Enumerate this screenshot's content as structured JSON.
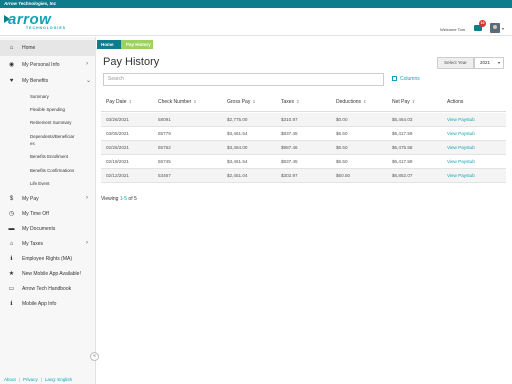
{
  "topbar": {
    "company": "Arrow Technologies, Inc"
  },
  "header": {
    "logo_text": "arrow",
    "logo_sub": "TECHNOLOGIES",
    "welcome": "Welcome Tom",
    "mail_count": "10"
  },
  "sidebar": {
    "items": [
      {
        "label": "Home",
        "icon": "home-icon",
        "glyph": "⌂"
      },
      {
        "label": "My Personal Info",
        "icon": "person-icon",
        "glyph": "◉",
        "chevron": "›"
      },
      {
        "label": "My Benefits",
        "icon": "heart-icon",
        "glyph": "♥",
        "chevron": "⌄"
      },
      {
        "label": "My Pay",
        "icon": "dollar-icon",
        "glyph": "$",
        "chevron": "›"
      },
      {
        "label": "My Time Off",
        "icon": "clock-icon",
        "glyph": "◷"
      },
      {
        "label": "My Documents",
        "icon": "folder-icon",
        "glyph": "▬"
      },
      {
        "label": "My Taxes",
        "icon": "bank-icon",
        "glyph": "⌂",
        "chevron": "›"
      },
      {
        "label": "Employee Rights (MA)",
        "icon": "info-icon",
        "glyph": "ℹ"
      },
      {
        "label": "New Mobile App Available!",
        "icon": "star-icon",
        "glyph": "★"
      },
      {
        "label": "Arrow Tech Handbook",
        "icon": "book-icon",
        "glyph": "▭"
      },
      {
        "label": "Mobile App Info",
        "icon": "info-icon",
        "glyph": "ℹ"
      }
    ],
    "benefits_sub": [
      "Summary",
      "Flexible Spending",
      "Retirement Summary",
      "Dependents/Beneficiar",
      "es",
      "Benefits Enrollment",
      "Benefits Confirmations",
      "Life Event"
    ],
    "collapse_glyph": "«"
  },
  "footer": {
    "about": "About",
    "privacy": "Privacy",
    "lang": "Lang: English"
  },
  "breadcrumb": {
    "home": "Home",
    "current": "Pay History"
  },
  "main": {
    "title": "Pay History",
    "select_year_label": "Select Year",
    "year_value": "2021",
    "search_placeholder": "Search",
    "columns_label": "Columns",
    "columns": [
      "Pay Date",
      "Check Number",
      "Gross Pay",
      "Taxes",
      "Deductions",
      "Net Pay",
      "Actions"
    ],
    "sort_glyph": "⇕",
    "rows": [
      [
        "03/26/2021",
        "58091",
        "$2,775.00",
        "$310.97",
        "$0.00",
        "$5,464.03",
        "View Paystub"
      ],
      [
        "03/05/2021",
        "55779",
        "$3,461.54",
        "$837.45",
        "$6.50",
        "$6,417.59",
        "View Paystub"
      ],
      [
        "02/26/2021",
        "55762",
        "$3,464.00",
        "$987.46",
        "$6.50",
        "$6,475.58",
        "View Paystub"
      ],
      [
        "02/19/2021",
        "55745",
        "$3,461.54",
        "$837.45",
        "$6.50",
        "$6,417.59",
        "View Paystub"
      ],
      [
        "02/12/2021",
        "53467",
        "$2,451.04",
        "$302.97",
        "$60.50",
        "$6,852.07",
        "View Paystub"
      ]
    ],
    "viewing_prefix": "Viewing ",
    "viewing_range": "1-5",
    "viewing_suffix": " of 5"
  },
  "colors": {
    "accent": "#11a3b5",
    "bar": "#0e7c8a",
    "crumb_active": "#9bd35c",
    "badge": "#d9342b"
  }
}
